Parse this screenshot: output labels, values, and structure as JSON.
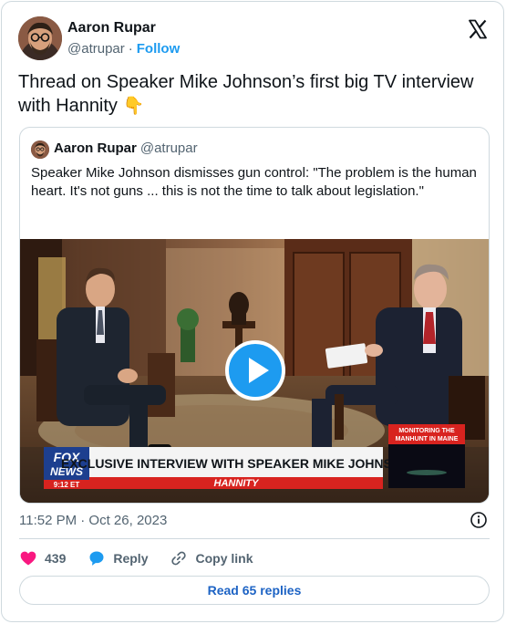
{
  "author": {
    "name": "Aaron Rupar",
    "handle": "@atrupar",
    "separator": "·",
    "follow_label": "Follow"
  },
  "tweet": {
    "text": "Thread on Speaker Mike Johnson’s first big TV interview with Hannity",
    "emoji": "👇"
  },
  "quote": {
    "name": "Aaron Rupar",
    "handle": "@atrupar",
    "text": "Speaker Mike Johnson dismisses gun control: \"The problem is the human heart. It's not guns ... this is not the time to talk about legislation.\"",
    "video": {
      "network_logo": "FOX NEWS",
      "time": "9:12 ET",
      "headline": "EXCLUSIVE INTERVIEW WITH SPEAKER MIKE JOHNSON",
      "show": "HANNITY",
      "side_banner": "MONITORING THE MANHUNT IN MAINE"
    }
  },
  "meta": {
    "timestamp": "11:52 PM · Oct 26, 2023"
  },
  "actions": {
    "like_count": "439",
    "reply_label": "Reply",
    "copy_label": "Copy link"
  },
  "footer": {
    "read_replies_label": "Read 65 replies"
  },
  "colors": {
    "accent": "#1d9bf0",
    "like": "#f91880",
    "secondary_text": "#536471",
    "border": "#cfd9de",
    "fox_red": "#d8231f",
    "fox_blue": "#1d3f8f"
  },
  "icons": [
    "x-logo-icon",
    "info-icon",
    "heart-icon",
    "reply-bubble-icon",
    "link-icon",
    "play-icon",
    "pointing-down-emoji-icon"
  ]
}
